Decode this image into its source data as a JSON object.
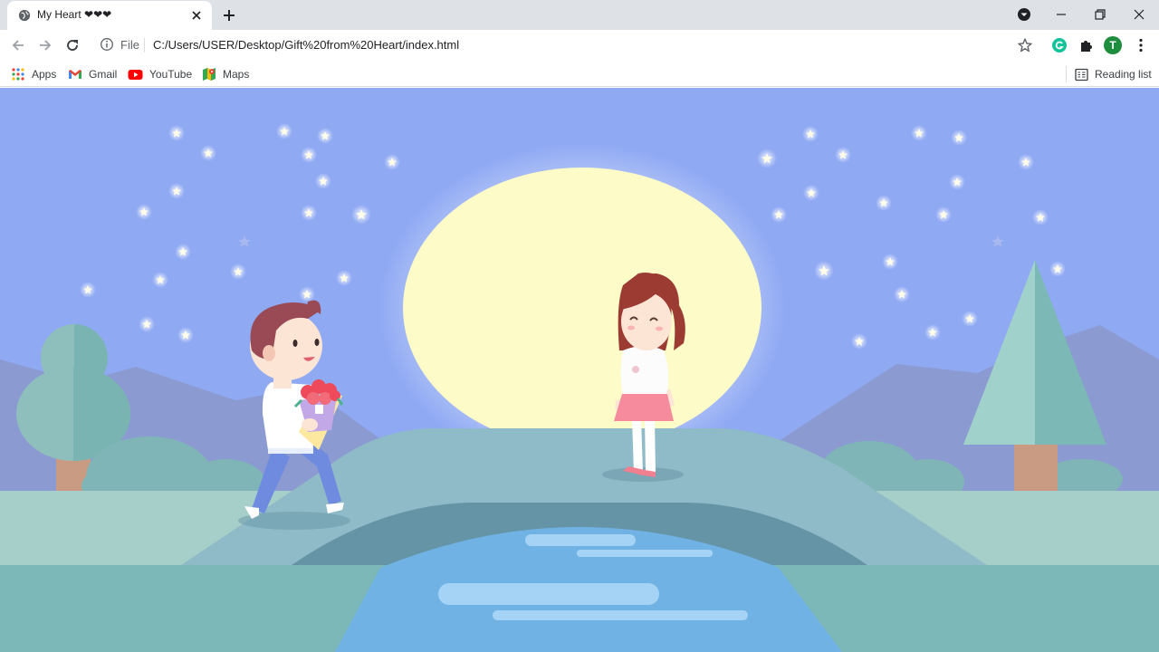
{
  "browser": {
    "tab": {
      "title": "My Heart ❤❤❤"
    },
    "address": {
      "scheme_label": "File",
      "url": "C:/Users/USER/Desktop/Gift%20from%20Heart/index.html"
    },
    "profile_initial": "T",
    "bookmarks": [
      {
        "label": "Apps",
        "icon": "apps-grid-icon"
      },
      {
        "label": "Gmail",
        "icon": "gmail-icon"
      },
      {
        "label": "YouTube",
        "icon": "youtube-icon"
      },
      {
        "label": "Maps",
        "icon": "maps-icon"
      }
    ],
    "reading_list_label": "Reading list"
  },
  "scene": {
    "description_colors": {
      "sky": "#8fa8f2",
      "moon": "#fdfbc8",
      "mountain": "#8b9bd1",
      "grass": "#a7cfc9",
      "bridge": "#8fbac8",
      "water": "#6fb2e3"
    },
    "figures": [
      "boy-with-bouquet",
      "girl-in-pink-skirt"
    ]
  }
}
